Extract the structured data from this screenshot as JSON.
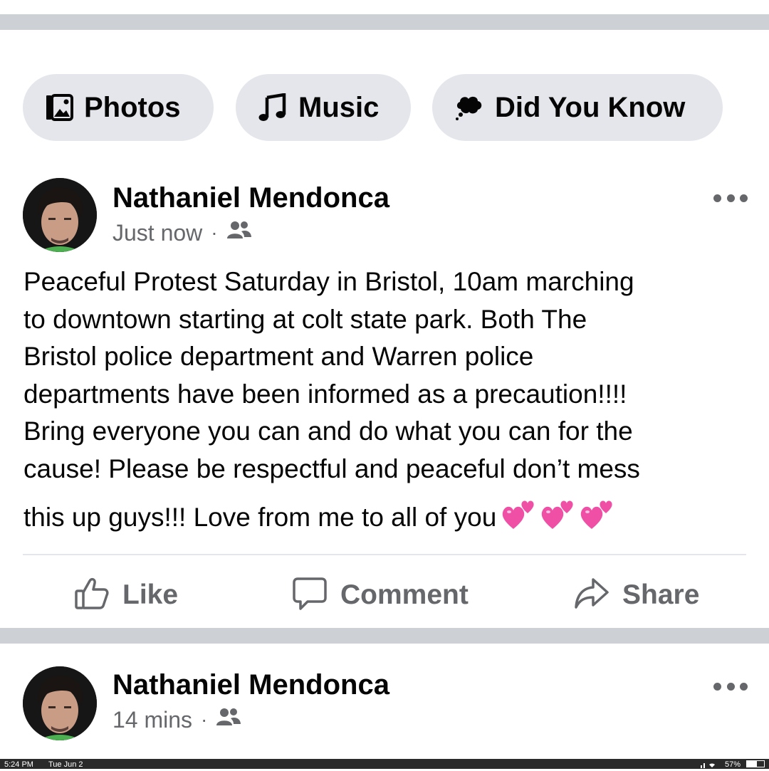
{
  "chips": [
    {
      "label": "Photos",
      "icon": "photos-icon"
    },
    {
      "label": "Music",
      "icon": "music-note-icon"
    },
    {
      "label": "Did You Know",
      "icon": "thought-bubble-icon"
    }
  ],
  "post1": {
    "author": "Nathaniel Mendonca",
    "time": "Just now",
    "separator": "·",
    "audience_icon": "friends-icon",
    "text_lines": [
      "Peaceful Protest Saturday in Bristol, 10am marching",
      "to downtown starting at colt state park. Both The",
      "Bristol police department and Warren police",
      "departments have been informed as a precaution!!!!",
      "Bring everyone you can and do what you can for the",
      "cause! Please be respectful and peaceful don’t mess",
      "this up guys!!! Love from me to all of you"
    ],
    "emoji_icon": "two-hearts-emoji",
    "emoji_count": 3,
    "more_icon": "more-options-icon"
  },
  "actions": {
    "like": "Like",
    "comment": "Comment",
    "share": "Share"
  },
  "post2": {
    "author": "Nathaniel Mendonca",
    "time": "14 mins",
    "separator": "·",
    "audience_icon": "friends-icon"
  },
  "status_bar": {
    "time": "5:24 PM",
    "date": "Tue Jun 2",
    "battery": "57%",
    "battery_level": 0.57
  },
  "colors": {
    "chip_bg": "#e4e6eb",
    "separator": "#cdd0d4",
    "secondary_text": "#65676b",
    "heart_pink": "#f04fa6"
  }
}
